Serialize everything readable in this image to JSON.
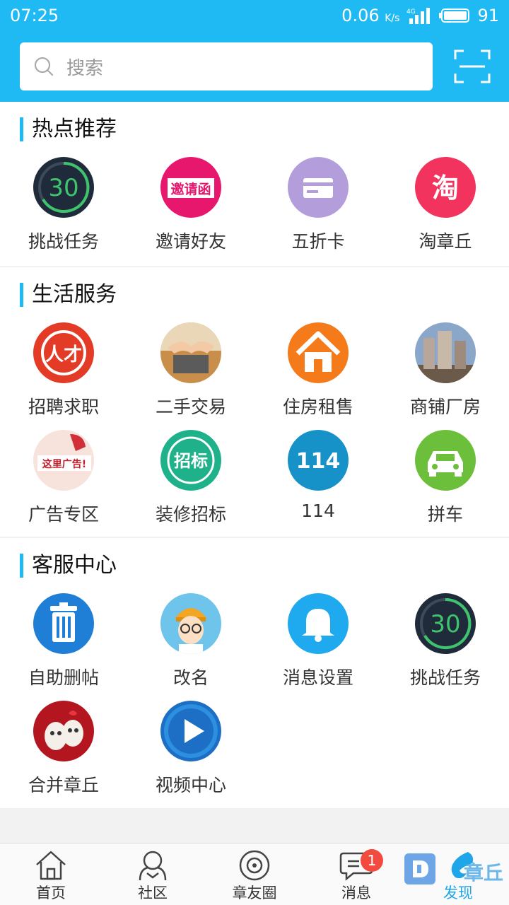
{
  "status_bar": {
    "time": "07:25",
    "speed": "0.06",
    "speed_unit": "K/s",
    "network": "4G",
    "battery": "91"
  },
  "search": {
    "placeholder": "搜索"
  },
  "sections": [
    {
      "title": "热点推荐",
      "items": [
        {
          "label": "挑战任务",
          "icon": "challenge-30-icon",
          "color": "#1f2b3a"
        },
        {
          "label": "邀请好友",
          "icon": "invite-letter-icon",
          "color": "#e8176e"
        },
        {
          "label": "五折卡",
          "icon": "card-icon",
          "color": "#b39ddb"
        },
        {
          "label": "淘章丘",
          "icon": "taobao-icon",
          "color": "#f2335e"
        }
      ]
    },
    {
      "title": "生活服务",
      "items": [
        {
          "label": "招聘求职",
          "icon": "job-icon",
          "color": "#e33b25"
        },
        {
          "label": "二手交易",
          "icon": "handshake-icon",
          "color": "#c98f4a"
        },
        {
          "label": "住房租售",
          "icon": "house-icon",
          "color": "#f47a1a"
        },
        {
          "label": "商铺厂房",
          "icon": "buildings-icon",
          "color": "#8aa6c9"
        },
        {
          "label": "广告专区",
          "icon": "ad-icon",
          "color": "#f7e3dc"
        },
        {
          "label": "装修招标",
          "icon": "bidding-icon",
          "color": "#1fb28a"
        },
        {
          "label": "114",
          "icon": "phone-114-icon",
          "color": "#1792c9"
        },
        {
          "label": "拼车",
          "icon": "car-icon",
          "color": "#6cbf3a"
        }
      ]
    },
    {
      "title": "客服中心",
      "items": [
        {
          "label": "自助删帖",
          "icon": "trash-icon",
          "color": "#1f7fd6"
        },
        {
          "label": "改名",
          "icon": "avatar-icon",
          "color": "#6ec4ea"
        },
        {
          "label": "消息设置",
          "icon": "bell-icon",
          "color": "#1faaf0"
        },
        {
          "label": "挑战任务",
          "icon": "challenge-30-icon",
          "color": "#1f2b3a"
        },
        {
          "label": "合并章丘",
          "icon": "eggs-icon",
          "color": "#b3161e"
        },
        {
          "label": "视频中心",
          "icon": "play-icon",
          "color": "#1c6fc4"
        }
      ]
    }
  ],
  "icon_text": {
    "challenge": "30",
    "invite": "邀请函",
    "taobao": "淘",
    "job": "人才",
    "ad": "这里广告!",
    "bidding": "招标",
    "phone": "114"
  },
  "tabs": [
    {
      "label": "首页",
      "icon": "home-icon"
    },
    {
      "label": "社区",
      "icon": "community-icon"
    },
    {
      "label": "章友圈",
      "icon": "friends-circle-icon"
    },
    {
      "label": "消息",
      "icon": "message-icon",
      "badge": "1"
    },
    {
      "label": "发现",
      "icon": "discover-icon",
      "active": true
    }
  ],
  "watermark": "章丘"
}
